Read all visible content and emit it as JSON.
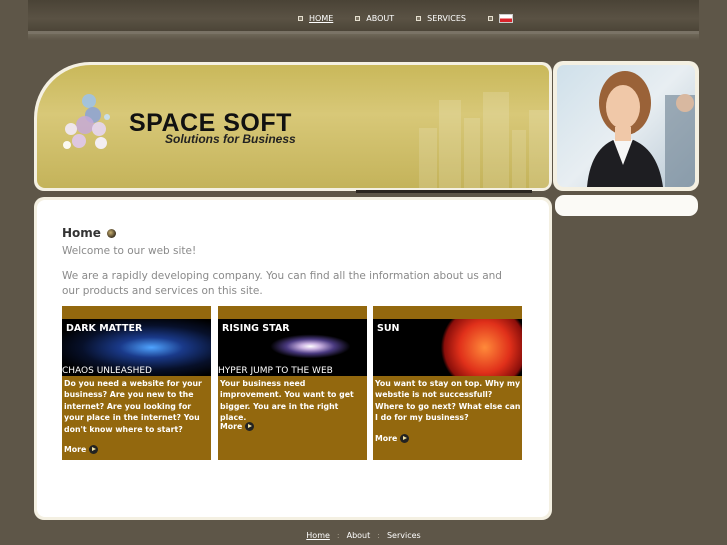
{
  "nav": {
    "items": [
      {
        "label": "HOME",
        "active": true
      },
      {
        "label": "ABOUT",
        "active": false
      },
      {
        "label": "SERVICES",
        "active": false
      }
    ],
    "flag_icon": "polish-flag-icon"
  },
  "header": {
    "logo_title": "SPACE SOFT",
    "logo_subtitle": "Solutions for Business"
  },
  "main": {
    "title": "Home",
    "welcome": "Welcome to our web site!",
    "intro": "We are a rapidly developing company. You can find all the information about us and our products and services on this site.",
    "cards": [
      {
        "title": "DARK MATTER",
        "subtitle": "CHAOS UNLEASHED",
        "description": "Do you need a website for your business? Are you new to the internet? Are you looking for your place in the internet? You don't know where to start?",
        "more": "More"
      },
      {
        "title": "RISING STAR",
        "subtitle": "HYPER JUMP TO THE WEB",
        "description": "Your business need improvement. You want to get bigger. You are in the right place.",
        "more": "More"
      },
      {
        "title": "SUN",
        "subtitle": "",
        "description": "You want to stay on top. Why my webstie is not successfull? Where to go next? What else can I do for my business?",
        "more": "More"
      }
    ]
  },
  "footer": {
    "links": [
      "Home",
      "About",
      "Services"
    ]
  },
  "colors": {
    "background": "#5e5648",
    "card": "#93680e",
    "banner": "#c9b85a"
  }
}
